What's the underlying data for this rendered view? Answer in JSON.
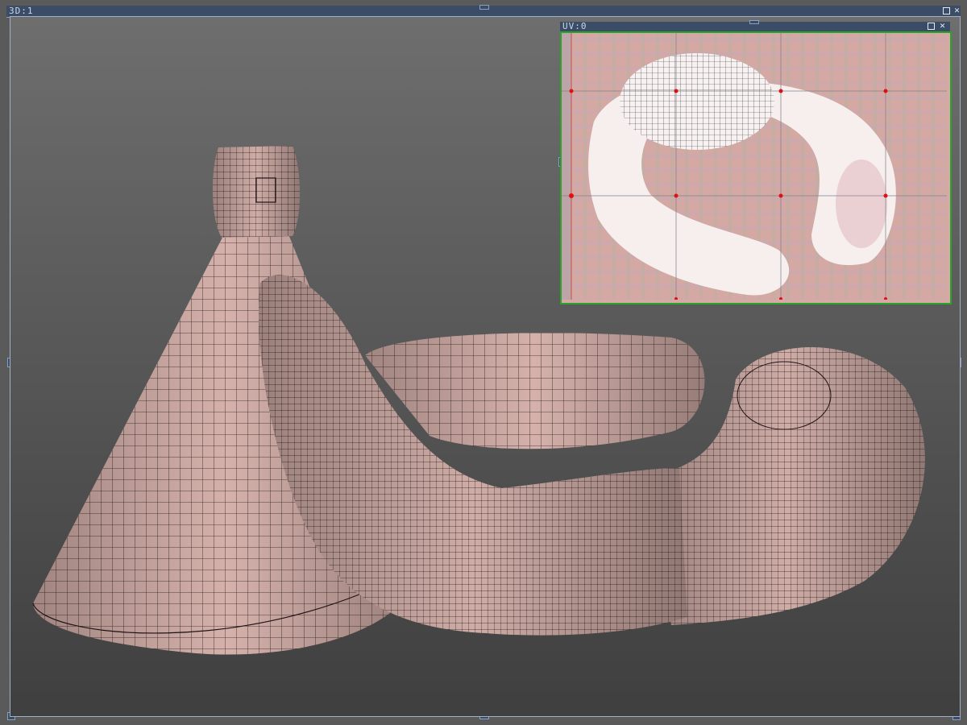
{
  "viewport3d": {
    "title": "3D:1"
  },
  "uv_editor": {
    "title": "UV:0"
  },
  "window_buttons": {
    "maximize": "maximize-icon",
    "close": "close-icon",
    "close_glyph": "✕"
  },
  "colors": {
    "titlebar": "#3b4d66",
    "uv_border": "#2aa52a",
    "uv_pin": "#e01010",
    "mesh_tint": "#d8b4ae"
  }
}
